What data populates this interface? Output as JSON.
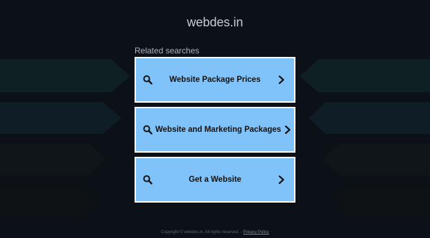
{
  "site": {
    "domain": "webdes.in"
  },
  "related": {
    "heading": "Related searches",
    "items": [
      {
        "label": "Website Package Prices",
        "icon": "search-icon",
        "action_icon": "chevron-right-icon"
      },
      {
        "label": "Website and Marketing Packages",
        "icon": "search-icon",
        "action_icon": "chevron-right-icon"
      },
      {
        "label": "Get a Website",
        "icon": "search-icon",
        "action_icon": "chevron-right-icon"
      }
    ]
  },
  "footer": {
    "copyright": "Copyright © webdes.in.  All rights reserved.",
    "separator": " - ",
    "privacy_label": "Privacy Policy"
  },
  "colors": {
    "background": "#0c1118",
    "card_fill": "#80c3fa",
    "card_border": "#ffffff",
    "text_light": "#c7cdd4"
  }
}
